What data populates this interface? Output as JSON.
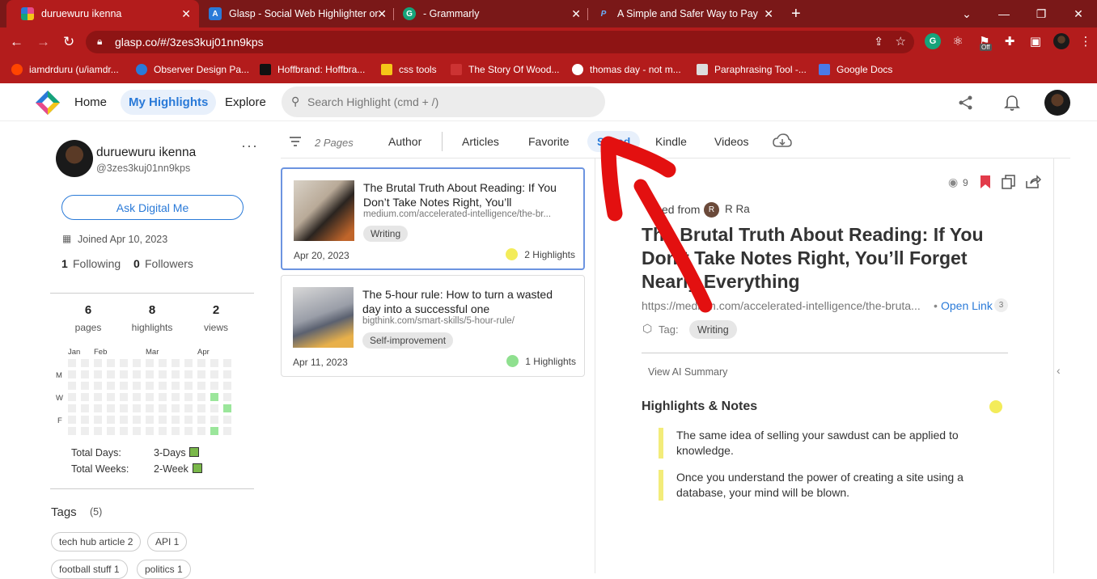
{
  "browser": {
    "tabs": [
      {
        "title": "duruewuru ikenna",
        "active": true,
        "favicon_color": "#e84a8a"
      },
      {
        "title": "Glasp - Social Web Highlighter or",
        "active": false,
        "favicon_color": "#2a7ad8"
      },
      {
        "title": "- Grammarly",
        "active": false,
        "favicon_color": "#16a37a"
      },
      {
        "title": "A Simple and Safer Way to Pay ar",
        "active": false,
        "favicon_color": "#1a3b8a"
      }
    ],
    "url": "glasp.co/#/3zes3kuj01nn9kps",
    "ext_badge": "Off",
    "bookmarks": [
      {
        "label": "iamdrduru (u/iamdr...",
        "color": "#ff4500"
      },
      {
        "label": "Observer Design Pa...",
        "color": "#2a7ad8"
      },
      {
        "label": "Hoffbrand: Hoffbra...",
        "color": "#111111"
      },
      {
        "label": "css tools",
        "color": "#f5c518"
      },
      {
        "label": "The Story Of Wood...",
        "color": "#cc3333"
      },
      {
        "label": "thomas day - not m...",
        "color": "#ffffff"
      },
      {
        "label": "Paraphrasing Tool -...",
        "color": "#dddddd"
      },
      {
        "label": "Google Docs",
        "color": "#4a7ae8"
      }
    ]
  },
  "header": {
    "nav": [
      "Home",
      "My Highlights",
      "Explore"
    ],
    "active_nav": "My Highlights",
    "search_placeholder": "Search Highlight (cmd + /)"
  },
  "profile": {
    "name": "duruewuru ikenna",
    "handle": "@3zes3kuj01nn9kps",
    "ask_button": "Ask Digital Me",
    "joined": "Joined Apr 10, 2023",
    "following_count": "1",
    "following_label": "Following",
    "followers_count": "0",
    "followers_label": "Followers",
    "stats": [
      {
        "value": "6",
        "label": "pages"
      },
      {
        "value": "8",
        "label": "highlights"
      },
      {
        "value": "2",
        "label": "views"
      }
    ],
    "heatmap_months": [
      "Jan",
      "Feb",
      "Mar",
      "Apr"
    ],
    "heatmap_days": [
      "M",
      "W",
      "F"
    ],
    "total_days_label": "Total Days:",
    "total_days_value": "3-Days",
    "total_weeks_label": "Total Weeks:",
    "total_weeks_value": "2-Week",
    "tags_title": "Tags",
    "tags_count": "(5)",
    "tags": [
      "tech hub article 2",
      "API 1",
      "football stuff 1",
      "politics 1"
    ]
  },
  "filters": {
    "pages_count": "2 Pages",
    "tabs": [
      "Author",
      "Articles",
      "Favorite",
      "Saved",
      "Kindle",
      "Videos"
    ],
    "active_tab": "Saved"
  },
  "cards": [
    {
      "title": "The Brutal Truth About Reading: If You Don’t Take Notes Right, You’ll",
      "url": "medium.com/accelerated-intelligence/the-br...",
      "tag": "Writing",
      "date": "Apr 20, 2023",
      "highlights": "2 Highlights",
      "dot_color": "#f3ec5a"
    },
    {
      "title": "The 5-hour rule: How to turn a wasted day into a successful one",
      "url": "bigthink.com/smart-skills/5-hour-rule/",
      "tag": "Self-improvement",
      "date": "Apr 11, 2023",
      "highlights": "1 Highlights",
      "dot_color": "#8fe08f"
    }
  ],
  "detail": {
    "views": "9",
    "saved_from_prefix": "ed from",
    "saved_from_user": "R Ra",
    "saved_from_initial": "R",
    "title": "The Brutal Truth About Reading: If You Don’t Take Notes Right, You’ll Forget Nearly Everything",
    "url": "https://medium.com/accelerated-intelligence/the-bruta...",
    "open_link": "Open Link",
    "open_link_count": "3",
    "tag_label": "Tag:",
    "tag": "Writing",
    "ai_summary": "View AI Summary",
    "highlights_title": "Highlights & Notes",
    "highlights": [
      "The same idea of selling your sawdust can be applied to knowledge.",
      "Once you understand the power of creating a site using a database, your mind will be blown."
    ]
  }
}
